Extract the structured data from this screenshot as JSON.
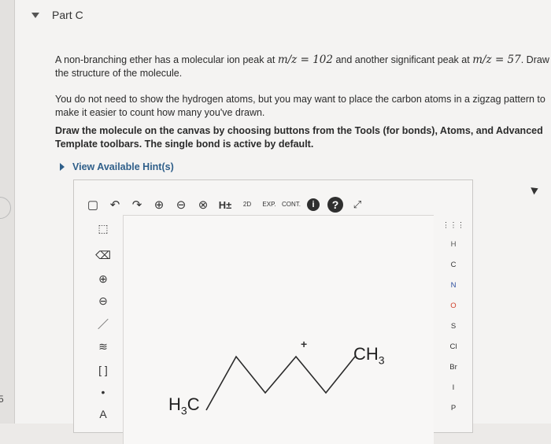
{
  "part": {
    "title": "Part C"
  },
  "question": {
    "line1_prefix": "A non-branching ether has a molecular ion peak at ",
    "m1": "m/z",
    "eq1": " = 102",
    "line1_mid": " and another significant peak at ",
    "m2": "m/z",
    "eq2": " = 57",
    "line1_suffix": ". Draw",
    "line2": "the structure of the molecule.",
    "p2_line1": "You do not need to show the hydrogen atoms, but you may want to place the carbon atoms in a zigzag pattern to",
    "p2_line2": "make it easier to count how many you've drawn.",
    "p3_line1": "Draw the molecule on the canvas by choosing buttons from the Tools (for bonds), Atoms, and Advanced",
    "p3_line2": "Template toolbars. The single bond is active by default."
  },
  "hint": {
    "label": "View Available Hint(s)"
  },
  "toolbar": {
    "items": [
      {
        "name": "new-icon",
        "glyph": "▢"
      },
      {
        "name": "undo-icon",
        "glyph": "↶"
      },
      {
        "name": "redo-icon",
        "glyph": "↷"
      },
      {
        "name": "zoom-in-icon",
        "glyph": "⊕"
      },
      {
        "name": "zoom-out-icon",
        "glyph": "⊖"
      },
      {
        "name": "clear-icon",
        "glyph": "⊗"
      },
      {
        "name": "hydrogens-toggle-icon",
        "glyph": "H±"
      },
      {
        "name": "clean-2d-icon",
        "glyph": "2D"
      },
      {
        "name": "expand-icon",
        "glyph": "EXP."
      },
      {
        "name": "contract-icon",
        "glyph": "CONT."
      },
      {
        "name": "info-icon",
        "glyph": "i"
      },
      {
        "name": "help-icon",
        "glyph": "?"
      },
      {
        "name": "fullscreen-icon",
        "glyph": "↙↗"
      }
    ]
  },
  "left_tools": [
    {
      "name": "select-tool-icon",
      "glyph": "⬚"
    },
    {
      "name": "erase-tool-icon",
      "glyph": "⌫"
    },
    {
      "name": "positive-charge-icon",
      "glyph": "⊕"
    },
    {
      "name": "negative-charge-icon",
      "glyph": "⊖"
    },
    {
      "name": "single-bond-icon",
      "glyph": "／"
    },
    {
      "name": "bond-variants-icon",
      "glyph": "≋"
    },
    {
      "name": "bracket-icon",
      "glyph": "[ ]"
    },
    {
      "name": "radical-icon",
      "glyph": "•"
    },
    {
      "name": "atom-label-icon",
      "glyph": "A"
    }
  ],
  "atoms": [
    "H",
    "C",
    "N",
    "O",
    "S",
    "Cl",
    "Br",
    "I",
    "P"
  ],
  "canvas": {
    "left_label_main": "H",
    "left_label_sub": "3",
    "left_label_tail": "C",
    "right_label_main": "CH",
    "right_label_sub": "3",
    "plus_sign": "+"
  },
  "gutter": {
    "number": "5"
  }
}
